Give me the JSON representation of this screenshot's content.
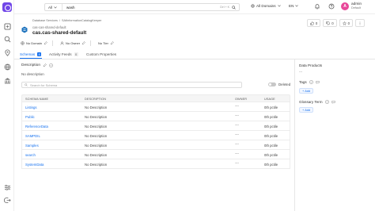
{
  "colors": {
    "accent": "#1470ef",
    "brand": "#7147e8",
    "avatar": "#e8489a"
  },
  "topbar": {
    "search_scope": "All",
    "search_value": "wash",
    "shortcut": "Ctrl + K",
    "domains_label": "All Domains",
    "language": "EN",
    "user_initial": "A",
    "user_name": "admin",
    "user_role": "Default"
  },
  "header": {
    "breadcrumb": [
      "Database Services",
      "SAtInformationCatalogKeeper"
    ],
    "breadcrumb_sep": "/",
    "service_name": "cas-cas-shared-default",
    "title": "cas.cas-shared-default",
    "domain_label": "No Domain",
    "owner_label": "No Owner",
    "tier_label": "No Tier",
    "upvotes": "0",
    "downvotes": "0",
    "followers": "0"
  },
  "tabs": [
    {
      "label": "Schemas",
      "count": "8"
    },
    {
      "label": "Activity Feeds",
      "count": "0"
    },
    {
      "label": "Custom Properties",
      "count": ""
    }
  ],
  "main": {
    "description_label": "Description",
    "description_text": "No description",
    "search_placeholder": "Search for Schema",
    "deleted_label": "Deleted",
    "columns": [
      "SCHEMA NAME",
      "DESCRIPTION",
      "OWNER",
      "USAGE"
    ],
    "rows": [
      {
        "name": "Listings",
        "description": "No Description",
        "owner": "---",
        "usage": "0th pctile"
      },
      {
        "name": "Public",
        "description": "No Description",
        "owner": "---",
        "usage": "0th pctile"
      },
      {
        "name": "ReferenceData",
        "description": "No Description",
        "owner": "---",
        "usage": "0th pctile"
      },
      {
        "name": "SAMPDIL",
        "description": "No Description",
        "owner": "---",
        "usage": "0th pctile"
      },
      {
        "name": "Samples",
        "description": "No Description",
        "owner": "---",
        "usage": "0th pctile"
      },
      {
        "name": "search",
        "description": "No Description",
        "owner": "---",
        "usage": "0th pctile"
      },
      {
        "name": "SystemData",
        "description": "No Description",
        "owner": "---",
        "usage": "0th pctile"
      }
    ]
  },
  "right_panel": {
    "data_products_label": "Data Products",
    "data_products_value": "---",
    "tags_label": "Tags",
    "glossary_label": "Glossary Term",
    "add_label": "Add"
  }
}
